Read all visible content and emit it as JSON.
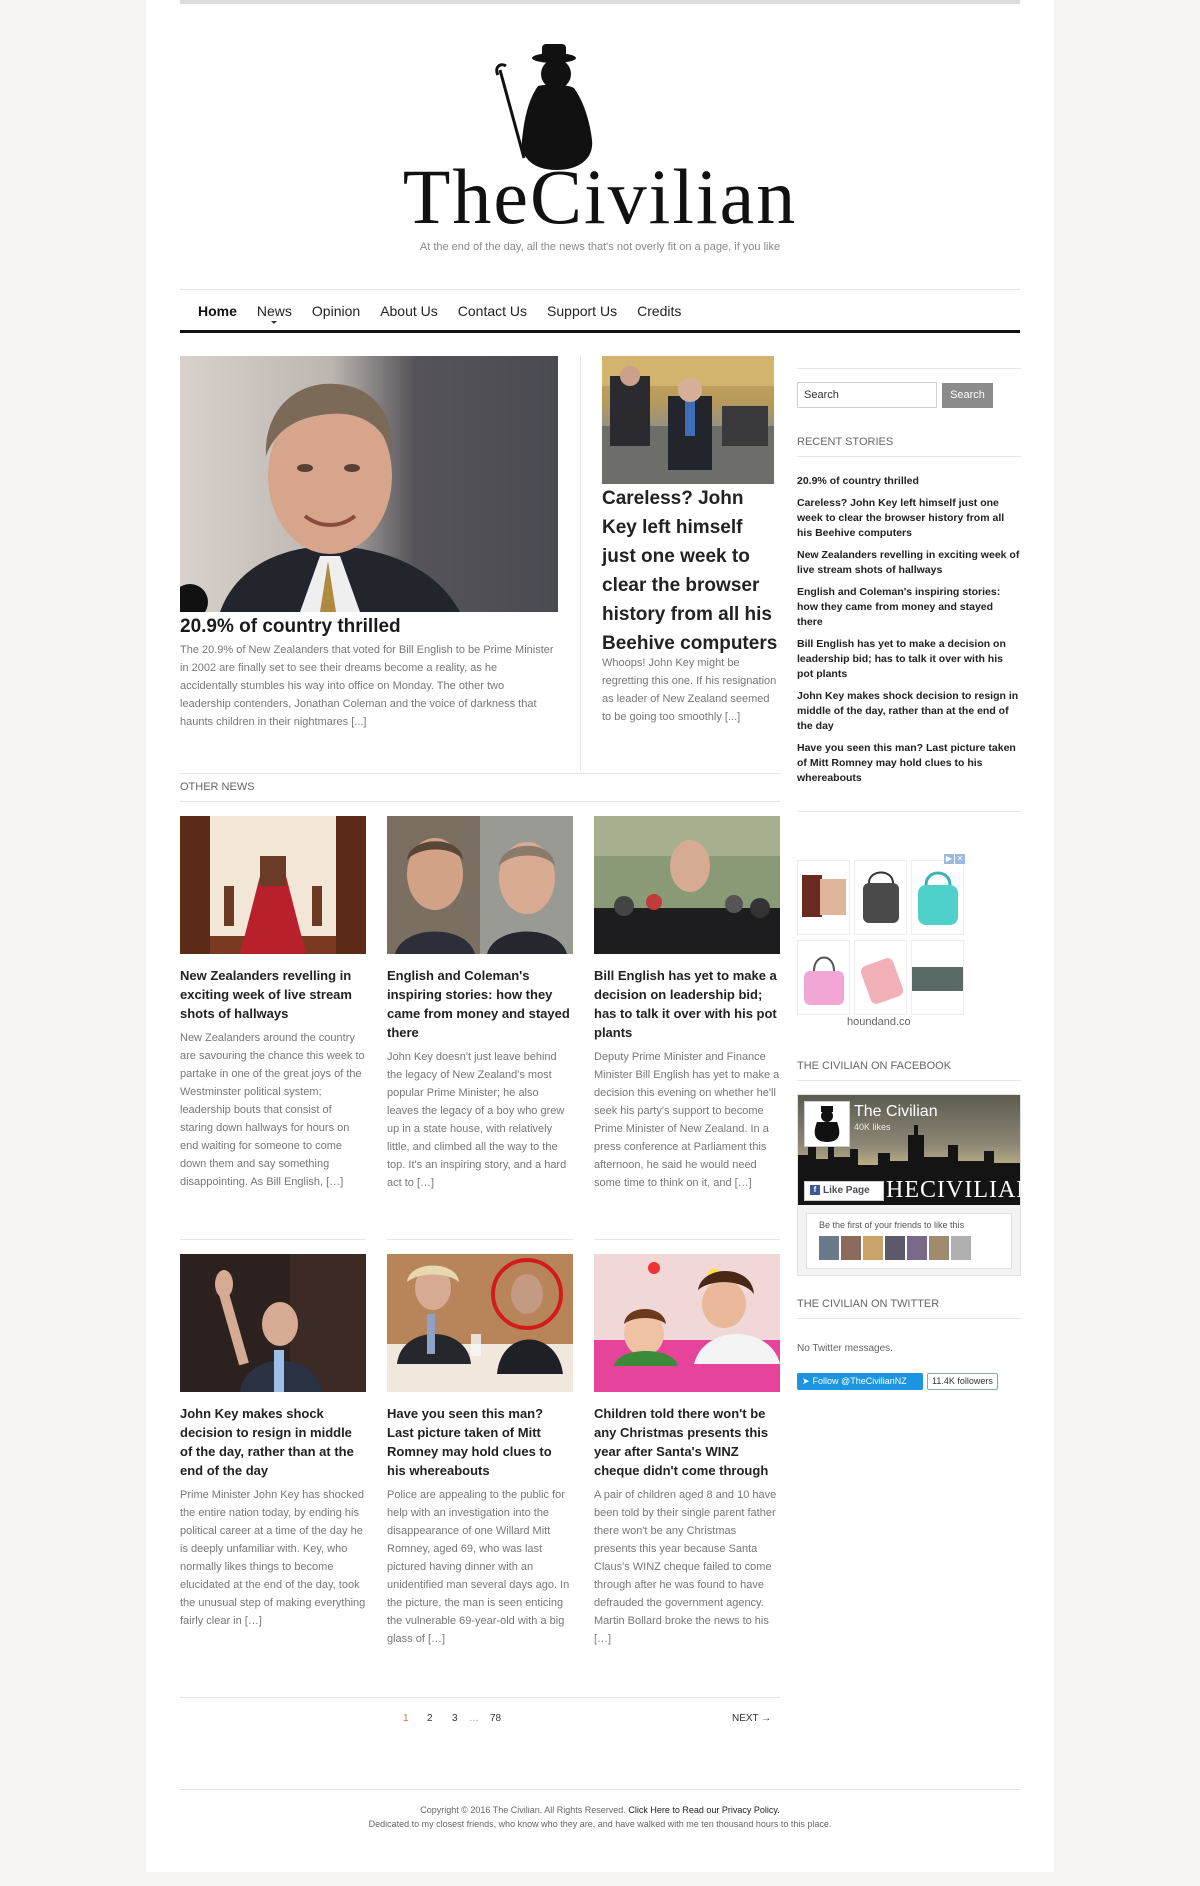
{
  "site": {
    "logo_text": "TheCivilian",
    "tagline": "At the end of the day, all the news that's not overly fit on a page, if you like"
  },
  "nav": {
    "items": [
      {
        "label": "Home"
      },
      {
        "label": "News"
      },
      {
        "label": "Opinion"
      },
      {
        "label": "About Us"
      },
      {
        "label": "Contact Us"
      },
      {
        "label": "Support Us"
      },
      {
        "label": "Credits"
      }
    ]
  },
  "featured": {
    "title": "20.9% of country thrilled",
    "excerpt": "The 20.9% of New Zealanders that voted for Bill English to be Prime Minister in 2002 are finally set to see their dreams become a reality, as he accidentally stumbles his way into office on Monday. The other two leadership contenders, Jonathan Coleman and the voice of darkness that haunts children in their nightmares [...]"
  },
  "secondary": {
    "title": "Careless? John Key left himself just one week to clear the browser history from all his Beehive computers",
    "excerpt": "Whoops! John Key might be regretting this one. If his resignation as leader of New Zealand seemed to be going too smoothly [...]"
  },
  "other_news": {
    "label": "OTHER NEWS",
    "cards": [
      {
        "title": "New Zealanders revelling in exciting week of live stream shots of hallways",
        "excerpt": "New Zealanders around the country are savouring the chance this week to partake in one of the great joys of the Westminster political system; leadership bouts that consist of staring down hallways for hours on end waiting for someone to come down them and say something disappointing. As Bill English, […]"
      },
      {
        "title": "English and Coleman's inspiring stories: how they came from money and stayed there",
        "excerpt": "John Key doesn't just leave behind the legacy of New Zealand's most popular Prime Minister; he also leaves the legacy of a boy who grew up in a state house, with relatively little, and climbed all the way to the top. It's an inspiring story, and a hard act to […]"
      },
      {
        "title": "Bill English has yet to make a decision on leadership bid; has to talk it over with his pot plants",
        "excerpt": "Deputy Prime Minister and Finance Minister Bill English has yet to make a decision this evening on whether he'll seek his party's support to become Prime Minister of New Zealand. In a press conference at Parliament this afternoon, he said he would need some time to think on it, and […]"
      },
      {
        "title": "John Key makes shock decision to resign in middle of the day, rather than at the end of the day",
        "excerpt": "Prime Minister John Key has shocked the entire nation today, by ending his political career at a time of the day he is deeply unfamiliar with. Key, who normally likes things to become elucidated at the end of the day, took the unusual step of making everything fairly clear in […]"
      },
      {
        "title": "Have you seen this man? Last picture taken of Mitt Romney may hold clues to his whereabouts",
        "excerpt": "Police are appealing to the public for help with an investigation into the disappearance of one Willard Mitt Romney, aged 69, who was last pictured having dinner with an unidentified man several days ago. In the picture, the man is seen enticing the vulnerable 69-year-old with a big glass of […]"
      },
      {
        "title": "Children told there won't be any Christmas presents this year after Santa's WINZ cheque didn't come through",
        "excerpt": "A pair of children aged 8 and 10 have been told by their single parent father there won't be any Christmas presents this year because Santa Claus's WINZ cheque failed to come through after he was found to have defrauded the government agency. Martin Bollard broke the news to his […]"
      }
    ]
  },
  "pagination": {
    "pages": [
      "1",
      "2",
      "3"
    ],
    "ellipsis": "…",
    "last": "78",
    "next": "NEXT →"
  },
  "sidebar": {
    "search_placeholder": "Search",
    "search_button": "Search",
    "recent_title": "RECENT STORIES",
    "recent": [
      "20.9% of country thrilled",
      "Careless? John Key left himself just one week to clear the browser history from all his Beehive computers",
      "New Zealanders revelling in exciting week of live stream shots of hallways",
      "English and Coleman's inspiring stories: how they came from money and stayed there",
      "Bill English has yet to make a decision on leadership bid; has to talk it over with his pot plants",
      "John Key makes shock decision to resign in middle of the day, rather than at the end of the day",
      "Have you seen this man? Last picture taken of Mitt Romney may hold clues to his whereabouts"
    ],
    "ad_url": "houndand.co",
    "facebook_title": "THE CIVILIAN ON FACEBOOK",
    "facebook": {
      "page_name": "The Civilian",
      "likes": "40K likes",
      "like_button": "Like Page",
      "brand": "HECIVILIAN",
      "friends_text": "Be the first of your friends to like this"
    },
    "twitter_title": "THE CIVILIAN ON TWITTER",
    "twitter": {
      "no_messages": "No Twitter messages.",
      "follow_button": "Follow @TheCivilianNZ",
      "followers": "11.4K followers"
    }
  },
  "footer": {
    "copyright": "Copyright © 2016 The Civilian. All Rights Reserved.",
    "privacy_link": "Click Here to Read our Privacy Policy.",
    "dedication": "Dedicated to my closest friends, who know who they are, and have walked with me ten thousand hours to this place."
  },
  "colors": {
    "accent_page_number": "#e06c3c",
    "twitter_blue": "#1b95e0",
    "search_button": "#8b8b8b"
  }
}
